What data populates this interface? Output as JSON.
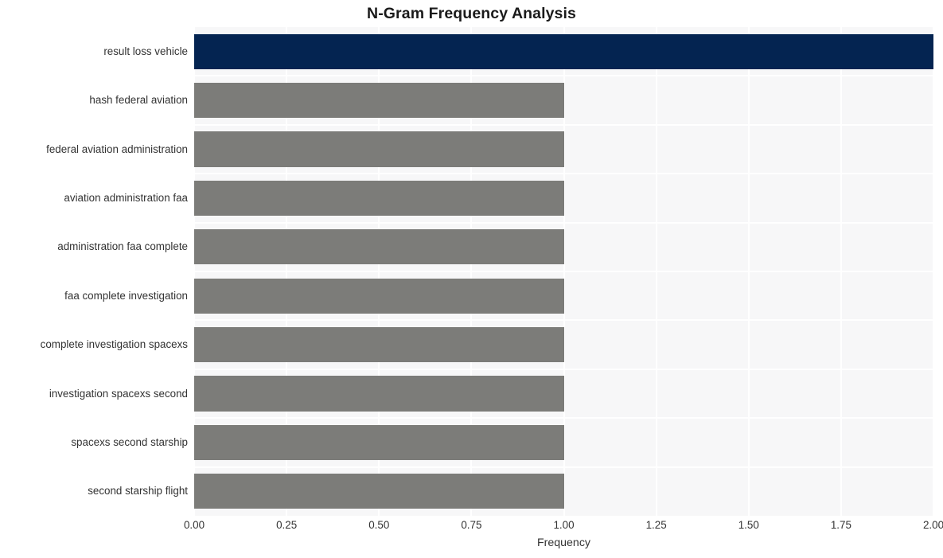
{
  "chart_data": {
    "type": "bar",
    "orientation": "horizontal",
    "title": "N-Gram Frequency Analysis",
    "xlabel": "Frequency",
    "ylabel": "",
    "xlim": [
      0,
      2.0
    ],
    "xticks": [
      "0.00",
      "0.25",
      "0.50",
      "0.75",
      "1.00",
      "1.25",
      "1.50",
      "1.75",
      "2.00"
    ],
    "xtick_values": [
      0,
      0.25,
      0.5,
      0.75,
      1.0,
      1.25,
      1.5,
      1.75,
      2.0
    ],
    "grid": true,
    "legend": false,
    "categories": [
      "result loss vehicle",
      "hash federal aviation",
      "federal aviation administration",
      "aviation administration faa",
      "administration faa complete",
      "faa complete investigation",
      "complete investigation spacexs",
      "investigation spacexs second",
      "spacexs second starship",
      "second starship flight"
    ],
    "values": [
      2,
      1,
      1,
      1,
      1,
      1,
      1,
      1,
      1,
      1
    ],
    "bar_colors": [
      "#042451",
      "#7c7c79",
      "#7c7c79",
      "#7c7c79",
      "#7c7c79",
      "#7c7c79",
      "#7c7c79",
      "#7c7c79",
      "#7c7c79",
      "#7c7c79"
    ],
    "highlight_color": "#042451",
    "default_bar_color": "#7c7c79",
    "plot_background": "#f7f7f8",
    "figure_background": "#ffffff",
    "gridline_color": "#ffffff",
    "text_color": "#333333",
    "title_color": "#1a1a1a"
  }
}
